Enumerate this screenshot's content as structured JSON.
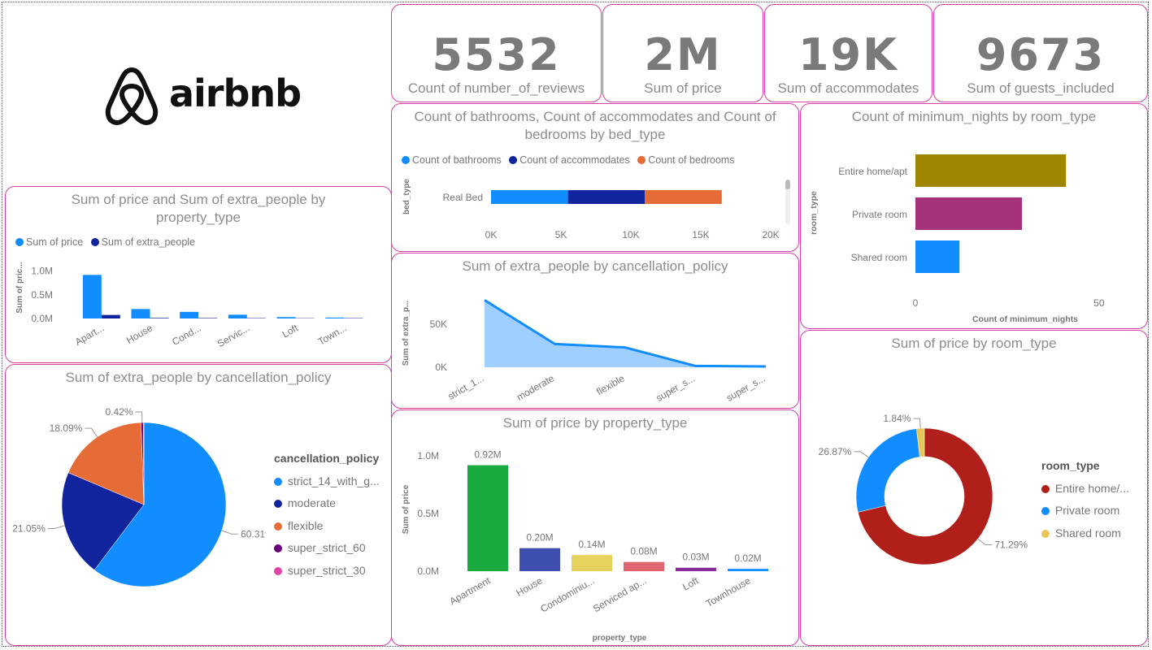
{
  "kpis": [
    {
      "value": "5532",
      "label": "Count of number_of_reviews"
    },
    {
      "value": "2M",
      "label": "Sum of price"
    },
    {
      "value": "19K",
      "label": "Sum of accommodates"
    },
    {
      "value": "9673",
      "label": "Sum of guests_included"
    }
  ],
  "logo": {
    "text": "airbnb"
  },
  "colors": {
    "border": "#d63fa5",
    "blue": "#118dff",
    "navy": "#12239e",
    "orange": "#e66c37",
    "purple": "#6b007b",
    "pink": "#e044a7",
    "olive": "#a08600",
    "magenta": "#a4317a",
    "green": "#1aab40",
    "indigo": "#3f4fb0",
    "yellow": "#e6d25c",
    "salmon": "#e06772",
    "violet": "#8a2c9c",
    "darkred": "#b01f1a",
    "gold": "#e8c75a",
    "area": "#9fcfff"
  },
  "chart_data": [
    {
      "id": "bed",
      "type": "bar",
      "orientation": "horizontal",
      "stacked": true,
      "title": "Count of bathrooms, Count of accommodates and Count of bedrooms by bed_type",
      "title_lines": [
        "Count of bathrooms, Count of accommodates and Count of",
        "bedrooms by bed_type"
      ],
      "categories": [
        "Real Bed"
      ],
      "series": [
        {
          "name": "Count of bathrooms",
          "values": [
            5500
          ]
        },
        {
          "name": "Count of accommodates",
          "values": [
            5500
          ]
        },
        {
          "name": "Count of bedrooms",
          "values": [
            5500
          ]
        }
      ],
      "ylabel": "bed_type",
      "xlim": [
        0,
        20000
      ],
      "xticks": [
        "0K",
        "5K",
        "10K",
        "15K",
        "20K"
      ],
      "legend": "top"
    },
    {
      "id": "minnights",
      "type": "bar",
      "orientation": "horizontal",
      "title": "Count of minimum_nights by room_type",
      "categories": [
        "Entire home/apt",
        "Private room",
        "Shared room"
      ],
      "values": [
        41,
        29,
        12
      ],
      "xlabel": "Count of minimum_nights",
      "ylabel": "room_type",
      "xlim": [
        0,
        60
      ],
      "xticks": [
        "0",
        "50"
      ]
    },
    {
      "id": "pricex",
      "type": "bar",
      "title": "Sum of price and Sum of extra_people by property_type",
      "title_lines": [
        "Sum of price and Sum of extra_people by",
        "property_type"
      ],
      "categories": [
        "Apart...",
        "House",
        "Cond...",
        "Servic...",
        "Loft",
        "Town..."
      ],
      "series": [
        {
          "name": "Sum of price",
          "values": [
            0.92,
            0.2,
            0.14,
            0.08,
            0.03,
            0.02
          ]
        },
        {
          "name": "Sum of extra_people",
          "values": [
            0.075,
            0.012,
            0.01,
            0.008,
            0.006,
            0.008
          ]
        }
      ],
      "ylabel": "Sum of pric...",
      "ylim": [
        0,
        1.2
      ],
      "yticks": [
        "0.0M",
        "0.5M",
        "1.0M"
      ],
      "legend": "top-left"
    },
    {
      "id": "extra",
      "type": "area",
      "title": "Sum of extra_people by cancellation_policy",
      "categories": [
        "strict_1...",
        "moderate",
        "flexible",
        "super_s...",
        "super_s..."
      ],
      "values": [
        78000,
        27000,
        23000,
        1500,
        900
      ],
      "ylabel": "Sum of extra_p...",
      "ylim": [
        0,
        85000
      ],
      "yticks": [
        "0K",
        "50K"
      ]
    },
    {
      "id": "pie",
      "type": "pie",
      "title": "Sum of extra_people by cancellation_policy",
      "legend_title": "cancellation_policy",
      "categories": [
        "strict_14_with_g...",
        "moderate",
        "flexible",
        "super_strict_60",
        "super_strict_30"
      ],
      "values": [
        60.31,
        21.05,
        18.09,
        0.42,
        0.13
      ],
      "labels": [
        "60.31%",
        "21.05%",
        "18.09%",
        "0.42%",
        ""
      ],
      "legend": "right"
    },
    {
      "id": "proptype",
      "type": "bar",
      "title": "Sum of price by property_type",
      "categories": [
        "Apartment",
        "House",
        "Condominiu...",
        "Serviced ap...",
        "Loft",
        "Townhouse"
      ],
      "values": [
        0.92,
        0.2,
        0.14,
        0.08,
        0.03,
        0.02
      ],
      "data_labels": [
        "0.92M",
        "0.20M",
        "0.14M",
        "0.08M",
        "0.03M",
        "0.02M"
      ],
      "xlabel": "property_type",
      "ylabel": "Sum of price",
      "ylim": [
        0,
        1.1
      ],
      "yticks": [
        "0.0M",
        "0.5M",
        "1.0M"
      ]
    },
    {
      "id": "donut",
      "type": "pie",
      "donut": true,
      "title": "Sum of price by room_type",
      "legend_title": "room_type",
      "categories": [
        "Entire home/...",
        "Private room",
        "Shared room"
      ],
      "values": [
        71.29,
        26.87,
        1.84
      ],
      "labels": [
        "71.29%",
        "26.87%",
        "1.84%"
      ],
      "legend": "right"
    }
  ]
}
